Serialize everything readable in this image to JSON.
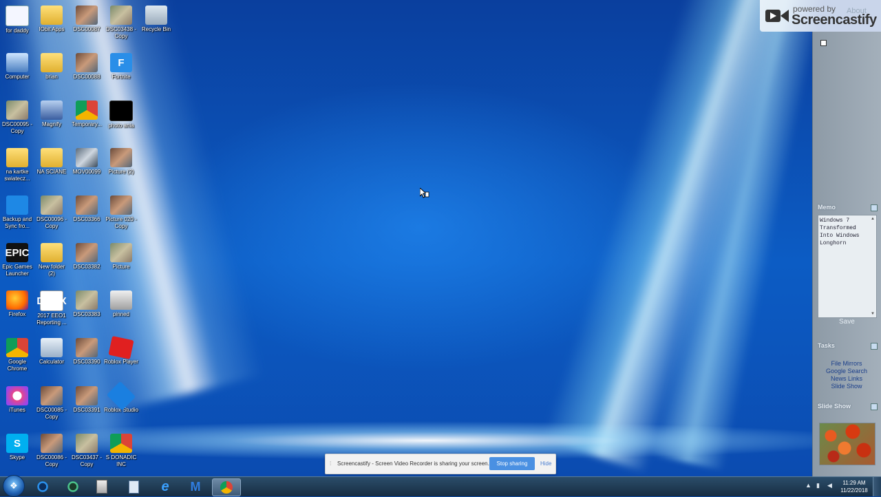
{
  "desktop": {
    "icons": [
      {
        "label": "for daddy",
        "icon": "document-icon"
      },
      {
        "label": "IObit Apps",
        "icon": "folder-icon"
      },
      {
        "label": "DSC00087",
        "icon": "photo-icon"
      },
      {
        "label": "DSC03438 - Copy",
        "icon": "photo-icon"
      },
      {
        "label": "Recycle Bin",
        "icon": "recycle-bin-icon"
      },
      {
        "label": "Computer",
        "icon": "computer-icon"
      },
      {
        "label": "brian",
        "icon": "folder-icon"
      },
      {
        "label": "DSC00088",
        "icon": "photo-icon"
      },
      {
        "label": "Fortnite",
        "icon": "fortnite-icon"
      },
      {
        "label": "DSC00095 - Copy",
        "icon": "photo-icon"
      },
      {
        "label": "Magnify",
        "icon": "magnify-icon"
      },
      {
        "label": "Temporary...",
        "icon": "chrome-icon"
      },
      {
        "label": "photo ania",
        "icon": "photo-icon"
      },
      {
        "label": "na kartke swiatecz...",
        "icon": "folder-icon"
      },
      {
        "label": "NA SCIANE",
        "icon": "folder-icon"
      },
      {
        "label": "MOV00099",
        "icon": "video-icon"
      },
      {
        "label": "Picture (2)",
        "icon": "photo-icon"
      },
      {
        "label": "Backup and Sync fro...",
        "icon": "backup-sync-icon"
      },
      {
        "label": "DSC00096 - Copy",
        "icon": "photo-icon"
      },
      {
        "label": "DSC03366",
        "icon": "photo-icon"
      },
      {
        "label": "Picture 020 - Copy",
        "icon": "photo-icon"
      },
      {
        "label": "Epic Games Launcher",
        "icon": "epic-games-icon"
      },
      {
        "label": "New folder (2)",
        "icon": "folder-icon"
      },
      {
        "label": "DSC03382",
        "icon": "photo-icon"
      },
      {
        "label": "Picture",
        "icon": "photo-icon"
      },
      {
        "label": "Firefox",
        "icon": "firefox-icon"
      },
      {
        "label": "2017 EEO1 Reporting ...",
        "icon": "docx-icon"
      },
      {
        "label": "DSC03383",
        "icon": "photo-icon"
      },
      {
        "label": "pinned",
        "icon": "pinned-icon"
      },
      {
        "label": "Google Chrome",
        "icon": "chrome-icon"
      },
      {
        "label": "Calculator",
        "icon": "calculator-icon"
      },
      {
        "label": "DSC03390",
        "icon": "photo-icon"
      },
      {
        "label": "Roblox Player",
        "icon": "roblox-icon"
      },
      {
        "label": "iTunes",
        "icon": "itunes-icon"
      },
      {
        "label": "DSC00085 - Copy",
        "icon": "photo-icon"
      },
      {
        "label": "DSC03391",
        "icon": "photo-icon"
      },
      {
        "label": "Roblox Studio",
        "icon": "roblox-studio-icon"
      },
      {
        "label": "Skype",
        "icon": "skype-icon"
      },
      {
        "label": "DSC00086 - Copy",
        "icon": "photo-icon"
      },
      {
        "label": "DSC03437 - Copy",
        "icon": "photo-icon"
      },
      {
        "label": "S DONADIC INC",
        "icon": "chrome-icon"
      }
    ]
  },
  "watermark": {
    "powered": "powered by",
    "brand": "Screencastify",
    "about": "About"
  },
  "sidebar": {
    "memo_title": "Memo",
    "memo_text": "Windows 7\nTransformed\nInto Windows\nLonghorn",
    "memo_save": "Save",
    "tasks_title": "Tasks",
    "tasks": [
      "File Mirrors",
      "Google Search",
      "News Links",
      "Slide Show"
    ],
    "slideshow_title": "Slide Show"
  },
  "share_banner": {
    "message": "Screencastify - Screen Video Recorder is sharing your screen.",
    "stop_label": "Stop sharing",
    "hide_label": "Hide"
  },
  "taskbar": {
    "start_glyph": "❖",
    "apps": [
      "ccleaner",
      "malwarebytes-shield",
      "file-manager",
      "notepad",
      "internet-explorer",
      "malwarebytes",
      "google-chrome"
    ],
    "active_app": "google-chrome",
    "clock_time": "11:29 AM",
    "clock_date": "11/22/2018"
  }
}
